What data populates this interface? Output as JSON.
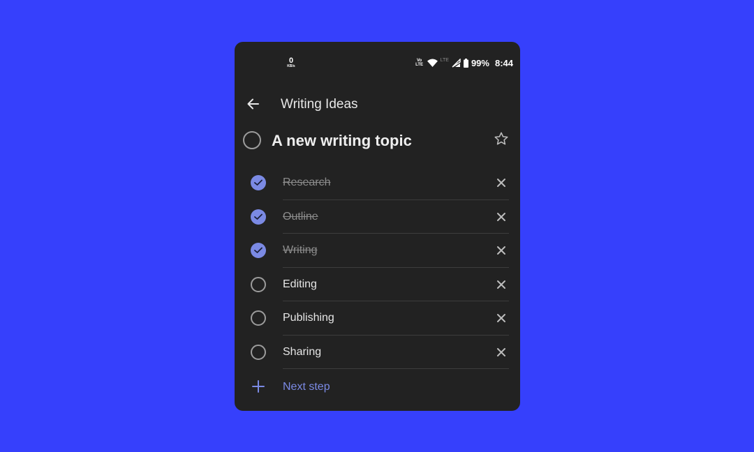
{
  "colors": {
    "background": "#3640fc",
    "panel": "#222222",
    "accent": "#7b8ae4",
    "text_primary": "#e6e6e6",
    "text_done": "#8c8c8c"
  },
  "status_bar": {
    "net_speed_value": "0",
    "net_speed_unit": "KB/s",
    "volte_top": "Vo",
    "volte_bottom": "LTE",
    "lte_label": "LTE",
    "battery_percent": "99%",
    "time": "8:44",
    "icons": [
      "volte-icon",
      "wifi-icon",
      "lte-icon",
      "signal-icon",
      "battery-icon"
    ]
  },
  "header": {
    "back_icon": "arrow-left-icon",
    "title": "Writing Ideas"
  },
  "task": {
    "title": "A new writing topic",
    "completed": false,
    "starred": false,
    "star_icon": "star-outline-icon"
  },
  "steps": [
    {
      "label": "Research",
      "completed": true
    },
    {
      "label": "Outline",
      "completed": true
    },
    {
      "label": "Writing",
      "completed": true
    },
    {
      "label": "Editing",
      "completed": false
    },
    {
      "label": "Publishing",
      "completed": false
    },
    {
      "label": "Sharing",
      "completed": false
    }
  ],
  "add_step": {
    "icon": "plus-icon",
    "label": "Next step"
  }
}
